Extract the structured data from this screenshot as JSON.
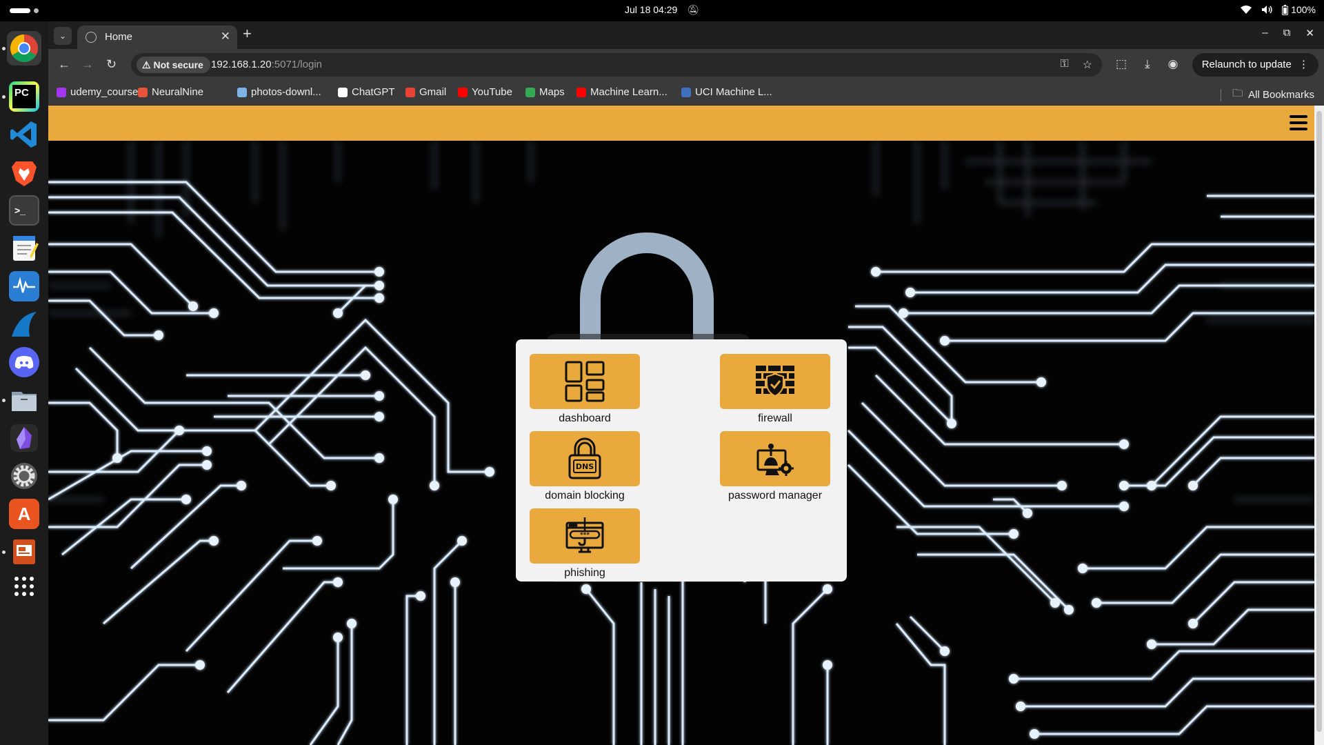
{
  "system_bar": {
    "datetime": "Jul 18  04:29",
    "battery": "100%"
  },
  "dock": {
    "apps": [
      "chrome-icon",
      "pycharm-icon",
      "vscode-icon",
      "brave-icon",
      "terminal-icon",
      "text-editor-icon",
      "system-monitor-icon",
      "wireshark-icon",
      "discord-icon",
      "files-icon",
      "obsidian-icon",
      "settings-icon",
      "app-center-icon",
      "impress-icon",
      "app-grid-icon"
    ]
  },
  "browser": {
    "tab_title": "Home",
    "security_label": "Not secure",
    "url_host": "192.168.1.20",
    "url_rest": ":5071/login",
    "relaunch_label": "Relaunch to update",
    "bookmarks": [
      {
        "label": "udemy_courses",
        "color": "#a435f0"
      },
      {
        "label": "NeuralNine",
        "color": "#e8533a"
      },
      {
        "label": "photos-downl...",
        "color": "#7fb3e6"
      },
      {
        "label": "ChatGPT",
        "color": "#ffffff"
      },
      {
        "label": "Gmail",
        "color": "#ea4335"
      },
      {
        "label": "YouTube",
        "color": "#ff0000"
      },
      {
        "label": "Maps",
        "color": "#34a853"
      },
      {
        "label": "Machine Learn...",
        "color": "#ff0000"
      },
      {
        "label": "UCI Machine L...",
        "color": "#3f6fbf"
      }
    ],
    "all_bookmarks_label": "All Bookmarks"
  },
  "page": {
    "accent_color": "#e9a93c",
    "tiles": [
      {
        "label": "dashboard",
        "icon": "dashboard-icon"
      },
      {
        "label": "firewall",
        "icon": "firewall-icon"
      },
      {
        "label": "domain blocking",
        "icon": "dns-lock-icon"
      },
      {
        "label": "password manager",
        "icon": "password-manager-icon"
      },
      {
        "label": "phishing",
        "icon": "phishing-icon"
      }
    ]
  }
}
